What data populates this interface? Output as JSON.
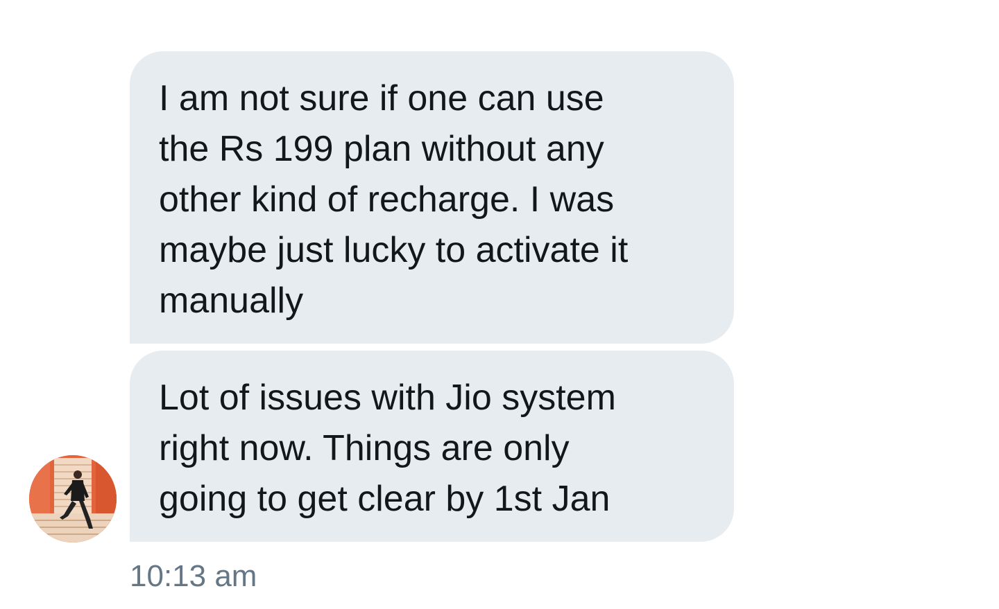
{
  "conversation": {
    "messages": [
      {
        "sender": "other",
        "text": "I am not sure if one can use\nthe Rs 199 plan without any\nother kind of recharge. I was\nmaybe just lucky to activate it\nmanually"
      },
      {
        "sender": "other",
        "text": "Lot of issues with Jio system\nright now. Things are only\ngoing to get clear by 1st Jan"
      }
    ],
    "timestamp": "10:13 am",
    "avatar": {
      "icon": "user-photo-avatar",
      "background_color": "#e2643d"
    }
  },
  "colors": {
    "bubble_background": "#e6ecf0",
    "text": "#14171a",
    "timestamp": "#657786"
  }
}
